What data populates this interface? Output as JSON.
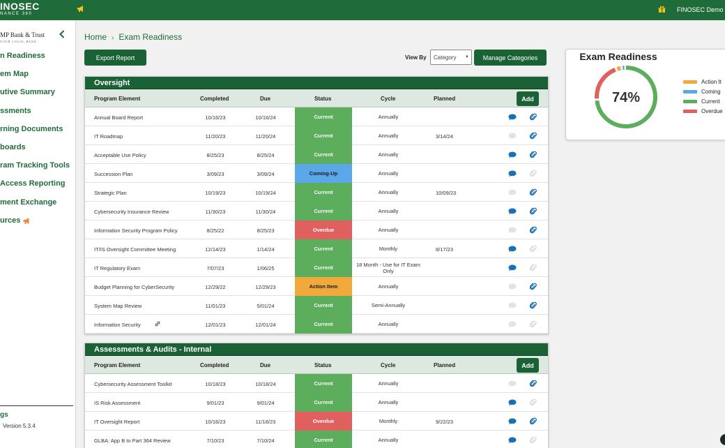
{
  "topbar": {
    "logo_main": "INOSEC",
    "logo_sub": "NANCE 360",
    "user": "FINOSEC Demo"
  },
  "sidebar": {
    "bank_name": "MP Bank & Trust",
    "bank_tagline": "YOUR LOCAL BANK",
    "items": [
      {
        "label": "n Readiness"
      },
      {
        "label": "em Map"
      },
      {
        "label": "utive Summary"
      },
      {
        "label": "ssments"
      },
      {
        "label": "rning Documents"
      },
      {
        "label": "boards"
      },
      {
        "label": "ram Tracking Tools"
      },
      {
        "label": "Access Reporting"
      },
      {
        "label": "ment Exchange"
      },
      {
        "label": "urces"
      }
    ],
    "settings_label": "gs",
    "version": "Version 5.3.4"
  },
  "breadcrumb": {
    "home": "Home",
    "separator": "›",
    "current": "Exam Readiness"
  },
  "toolbar": {
    "export_label": "Export Report",
    "view_by_label": "View By",
    "view_by_value": "Category",
    "manage_label": "Manage Categories"
  },
  "columns": {
    "element": "Program Element",
    "completed": "Completed",
    "due": "Due",
    "status": "Status",
    "cycle": "Cycle",
    "planned": "Planned",
    "add": "Add"
  },
  "status_colors": {
    "Current": "#5cad5c",
    "Coming-Up": "#5aa7ea",
    "Overdue": "#e06060",
    "Action Item": "#f2a93b"
  },
  "sections": [
    {
      "title": "Oversight",
      "rows": [
        {
          "element": "Annual Board Report",
          "completed": "10/16/23",
          "due": "10/16/24",
          "status": "Current",
          "cycle": "Annually",
          "planned": "",
          "chat": true,
          "clip": true,
          "link": false
        },
        {
          "element": "IT Roadmap",
          "completed": "11/20/23",
          "due": "11/20/24",
          "status": "Current",
          "cycle": "Annually",
          "planned": "3/14/24",
          "chat": false,
          "clip": true,
          "link": false
        },
        {
          "element": "Acceptable Use Policy",
          "completed": "8/25/23",
          "due": "8/25/24",
          "status": "Current",
          "cycle": "Annually",
          "planned": "",
          "chat": true,
          "clip": true,
          "link": false
        },
        {
          "element": "Succession Plan",
          "completed": "3/09/23",
          "due": "3/09/24",
          "status": "Coming-Up",
          "cycle": "Annually",
          "planned": "",
          "chat": true,
          "clip": false,
          "link": false
        },
        {
          "element": "Strategic Plan",
          "completed": "10/19/23",
          "due": "10/19/24",
          "status": "Current",
          "cycle": "Annually",
          "planned": "10/09/23",
          "chat": false,
          "clip": true,
          "link": false
        },
        {
          "element": "Cybersecurity Insurance Review",
          "completed": "11/30/23",
          "due": "11/30/24",
          "status": "Current",
          "cycle": "Annually",
          "planned": "",
          "chat": true,
          "clip": true,
          "link": false
        },
        {
          "element": "Information Security Program Policy",
          "completed": "8/25/22",
          "due": "8/25/23",
          "status": "Overdue",
          "cycle": "Annually",
          "planned": "",
          "chat": false,
          "clip": true,
          "link": false
        },
        {
          "element": "IT/IS Oversight Committee Meeting",
          "completed": "12/14/23",
          "due": "1/14/24",
          "status": "Current",
          "cycle": "Monthly",
          "planned": "8/17/23",
          "chat": true,
          "clip": false,
          "link": false
        },
        {
          "element": "IT Regulatory Exam",
          "completed": "7/07/23",
          "due": "1/06/25",
          "status": "Current",
          "cycle": "18 Month - Use for IT Exam Only",
          "planned": "",
          "chat": true,
          "clip": false,
          "link": false
        },
        {
          "element": "Budget Planning for CyberSecurity",
          "completed": "12/29/22",
          "due": "12/29/23",
          "status": "Action Item",
          "cycle": "Annually",
          "planned": "",
          "chat": false,
          "clip": true,
          "link": false
        },
        {
          "element": "System Map Review",
          "completed": "11/01/23",
          "due": "5/01/24",
          "status": "Current",
          "cycle": "Semi-Annually",
          "planned": "",
          "chat": false,
          "clip": true,
          "link": false
        },
        {
          "element": "Information Security",
          "completed": "12/01/23",
          "due": "12/01/24",
          "status": "Current",
          "cycle": "Annually",
          "planned": "",
          "chat": false,
          "clip": false,
          "link": true
        }
      ]
    },
    {
      "title": "Assessments & Audits - Internal",
      "rows": [
        {
          "element": "Cybersecurity Assessment Toolkit",
          "completed": "10/18/23",
          "due": "10/18/24",
          "status": "Current",
          "cycle": "Annually",
          "planned": "",
          "chat": false,
          "clip": true,
          "link": false
        },
        {
          "element": "IS Risk Assessment",
          "completed": "9/01/23",
          "due": "9/01/24",
          "status": "Current",
          "cycle": "Annually",
          "planned": "",
          "chat": true,
          "clip": false,
          "link": false
        },
        {
          "element": "IT Oversight Report",
          "completed": "10/16/23",
          "due": "11/16/23",
          "status": "Overdue",
          "cycle": "Monthly",
          "planned": "9/22/23",
          "chat": true,
          "clip": true,
          "link": false
        },
        {
          "element": "GLBA: App B to Part 364 Review",
          "completed": "7/10/23",
          "due": "7/10/24",
          "status": "Current",
          "cycle": "Annually",
          "planned": "",
          "chat": true,
          "clip": false,
          "link": false
        }
      ]
    }
  ],
  "exam_readiness": {
    "title": "Exam Readiness",
    "percent_label": "74%",
    "legend": [
      {
        "label": "Action It",
        "color": "#f2a93b",
        "value": 3
      },
      {
        "label": "Coming",
        "color": "#5aa7ea",
        "value": 2
      },
      {
        "label": "Current",
        "color": "#5cad5c",
        "value": 74
      },
      {
        "label": "Overdue",
        "color": "#e06060",
        "value": 21
      }
    ]
  }
}
